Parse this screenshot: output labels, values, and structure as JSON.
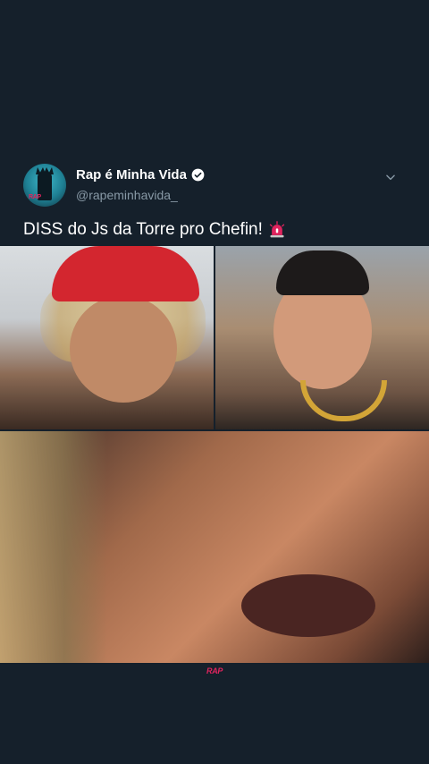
{
  "tweet": {
    "display_name": "Rap é Minha Vida",
    "handle": "@rapeminhavida_",
    "text": "DISS do Js da Torre pro Chefin!",
    "verified": true,
    "emoji_icon": "siren-icon"
  },
  "media": {
    "count": 3,
    "watermark": "RAP"
  },
  "colors": {
    "background": "#15202b",
    "text_primary": "#ffffff",
    "text_secondary": "#8899a6",
    "verified": "#ffffff",
    "accent": "#e0245e"
  }
}
